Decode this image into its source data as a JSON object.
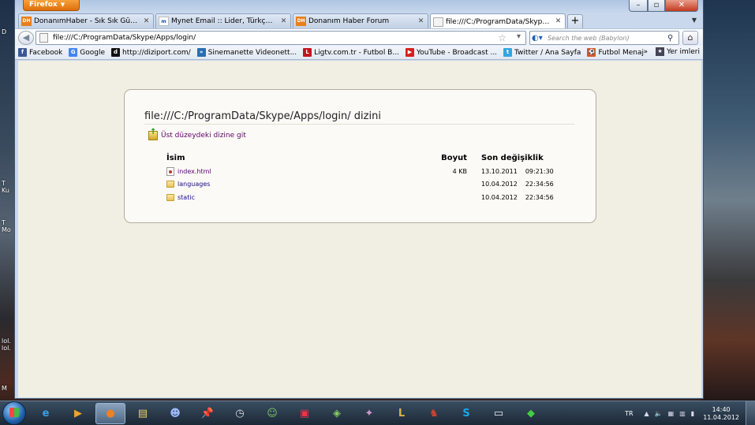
{
  "browser": {
    "menu_label": "Firefox",
    "tabs": [
      {
        "icon": "DH",
        "title": "DonanımHaber - Sık Sık Güncellenen ...",
        "active": false
      },
      {
        "icon": "m",
        "title": "Mynet Email :: Lider, Türkçe Email Ser...",
        "active": false
      },
      {
        "icon": "DH",
        "title": "Donanım Haber Forum",
        "active": false
      },
      {
        "icon": "",
        "title": "file:///C:/ProgramData/Skype/Apps/l...",
        "active": true
      }
    ],
    "new_tab": "+",
    "url": "file:///C:/ProgramData/Skype/Apps/login/",
    "search_placeholder": "Search the web (Babylon)",
    "bookmarks": [
      {
        "icon": "f",
        "color": "#3b5998",
        "label": "Facebook"
      },
      {
        "icon": "G",
        "color": "#4285f4",
        "label": "Google"
      },
      {
        "icon": "d",
        "color": "#111111",
        "label": "http://diziport.com/"
      },
      {
        "icon": "»",
        "color": "#2a6db0",
        "label": "Sinemanette Videonett..."
      },
      {
        "icon": "L",
        "color": "#c0171e",
        "label": "Ligtv.com.tr - Futbol B..."
      },
      {
        "icon": "▶",
        "color": "#d61f1f",
        "label": "YouTube - Broadcast ..."
      },
      {
        "icon": "t",
        "color": "#33a5e0",
        "label": "Twitter / Ana Sayfa"
      },
      {
        "icon": "⚽",
        "color": "#d8542a",
        "label": "Futbol Menajeri - Dün..."
      }
    ],
    "bookmarks_more": "»",
    "bookmarks_other": "Yer imleri"
  },
  "listing": {
    "title": "file:///C:/ProgramData/Skype/Apps/login/ dizini",
    "parent_link": "Üst düzeydeki dizine git",
    "columns": {
      "name": "İsim",
      "size": "Boyut",
      "modified": "Son değişiklik"
    },
    "rows": [
      {
        "type": "file",
        "name": "index.html",
        "size": "4 KB",
        "date": "13.10.2011",
        "time": "09:21:30"
      },
      {
        "type": "folder",
        "name": "languages",
        "size": "",
        "date": "10.04.2012",
        "time": "22:34:56"
      },
      {
        "type": "folder",
        "name": "static",
        "size": "",
        "date": "10.04.2012",
        "time": "22:34:56"
      }
    ]
  },
  "desktop_fragments": [
    "D",
    "T",
    "Ku",
    "T",
    "Mo",
    "lol.",
    "lol.",
    "M"
  ],
  "taskbar": {
    "language": "TR",
    "time": "14:40",
    "date": "11.04.2012"
  },
  "colors": {
    "page_bg": "#f1efe3",
    "link": "#1a0a8c",
    "visited_link": "#5a0070",
    "firefox_orange": "#e97f1c"
  }
}
